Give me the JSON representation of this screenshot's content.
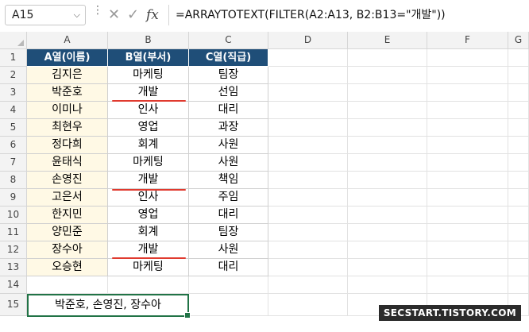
{
  "formula_bar": {
    "name_box": "A15",
    "cancel_icon": "close-icon",
    "enter_icon": "check-icon",
    "fx_label": "fx",
    "formula": "=ARRAYTOTEXT(FILTER(A2:A13, B2:B13=\"개발\"))"
  },
  "columns": [
    "A",
    "B",
    "C",
    "D",
    "E",
    "F",
    "G"
  ],
  "rows": [
    "1",
    "2",
    "3",
    "4",
    "5",
    "6",
    "7",
    "8",
    "9",
    "10",
    "11",
    "12",
    "13",
    "14",
    "15"
  ],
  "table": {
    "headers": [
      "A열(이름)",
      "B열(부서)",
      "C열(직급)"
    ],
    "rows": [
      [
        "김지은",
        "마케팅",
        "팀장"
      ],
      [
        "박준호",
        "개발",
        "선임"
      ],
      [
        "이미나",
        "인사",
        "대리"
      ],
      [
        "최현우",
        "영업",
        "과장"
      ],
      [
        "정다희",
        "회계",
        "사원"
      ],
      [
        "윤태식",
        "마케팅",
        "사원"
      ],
      [
        "손영진",
        "개발",
        "책임"
      ],
      [
        "고은서",
        "인사",
        "주임"
      ],
      [
        "한지민",
        "영업",
        "대리"
      ],
      [
        "양민준",
        "회계",
        "팀장"
      ],
      [
        "장수아",
        "개발",
        "사원"
      ],
      [
        "오승현",
        "마케팅",
        "대리"
      ]
    ]
  },
  "result": "박준호, 손영진, 장수아",
  "watermark": "SECSTART.TISTORY.COM",
  "colors": {
    "header_bg": "#1f4e78",
    "name_col_bg": "#fff9e5",
    "underline": "#e03a2f",
    "selection": "#217346"
  }
}
